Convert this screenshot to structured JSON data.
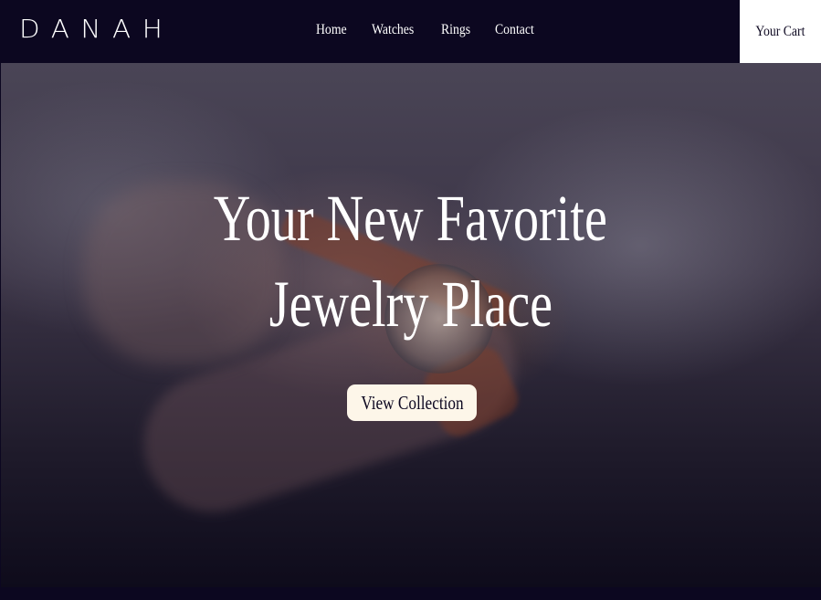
{
  "brand": {
    "logo": "DANAH"
  },
  "nav": {
    "items": [
      {
        "label": "Home"
      },
      {
        "label": "Watches"
      },
      {
        "label": "Rings"
      },
      {
        "label": "Contact"
      }
    ],
    "cart_label": "Your Cart"
  },
  "hero": {
    "headline_line1": "Your New Favorite",
    "headline_line2": "Jewelry Place",
    "cta_label": "View Collection"
  },
  "colors": {
    "navbar_bg": "#0c0720",
    "cta_bg": "#fdf6e9",
    "text_light": "#ffffff"
  }
}
